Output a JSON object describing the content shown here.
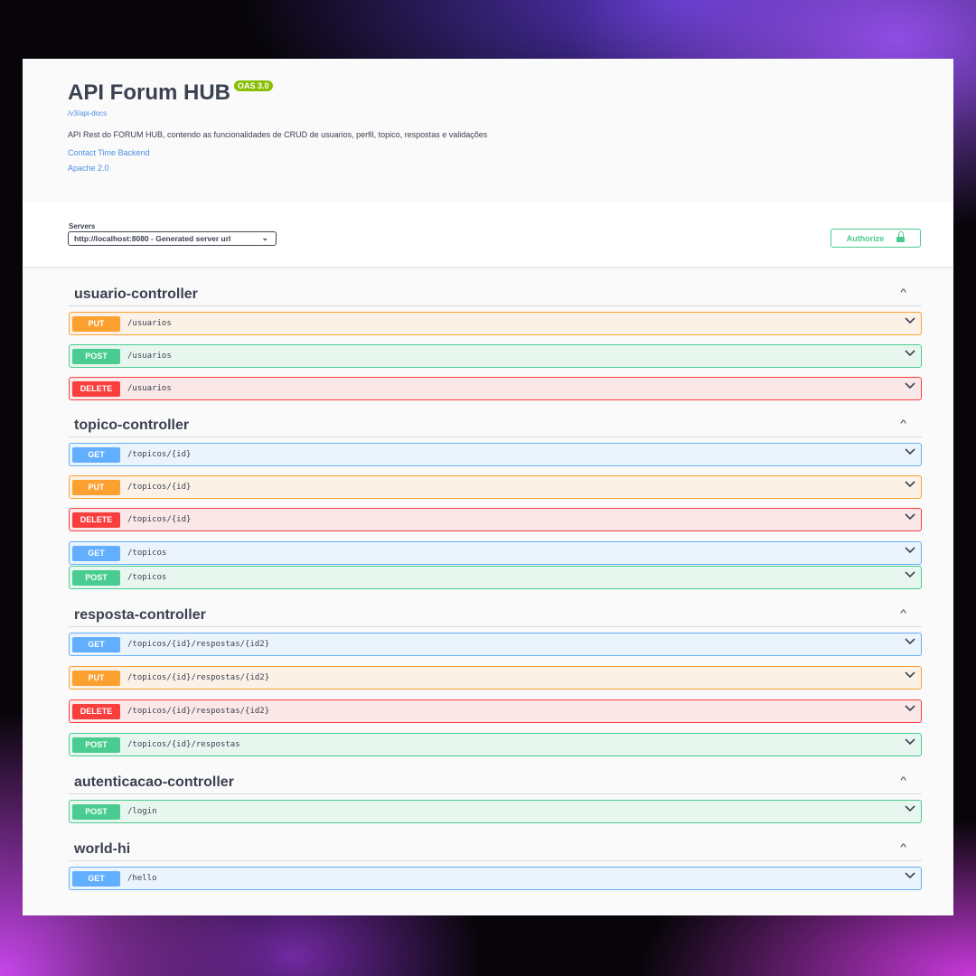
{
  "info": {
    "title": "API Forum HUB",
    "version_badge": "OAS 3.0",
    "spec_url": "/v3/api-docs",
    "description": "API Rest do FORUM HUB, contendo as funcionalidades de CRUD de usuarios, perfil, topico, respostas e validações",
    "contact_link": "Contact Time Backend",
    "license_link": "Apache 2.0"
  },
  "servers": {
    "label": "Servers",
    "selected": "http://localhost:8080 - Generated server url"
  },
  "authorize": {
    "label": "Authorize",
    "icon": "lock-icon"
  },
  "colors": {
    "get": "#61affe",
    "post": "#49cc90",
    "put": "#fca130",
    "delete": "#f93e3e"
  },
  "tags": [
    {
      "name": "usuario-controller",
      "ops": [
        {
          "method": "PUT",
          "path": "/usuarios"
        },
        {
          "method": "POST",
          "path": "/usuarios"
        },
        {
          "method": "DELETE",
          "path": "/usuarios"
        }
      ]
    },
    {
      "name": "topico-controller",
      "ops": [
        {
          "method": "GET",
          "path": "/topicos/{id}"
        },
        {
          "method": "PUT",
          "path": "/topicos/{id}"
        },
        {
          "method": "DELETE",
          "path": "/topicos/{id}"
        },
        {
          "method": "GET",
          "path": "/topicos"
        },
        {
          "method": "POST",
          "path": "/topicos"
        }
      ]
    },
    {
      "name": "resposta-controller",
      "ops": [
        {
          "method": "GET",
          "path": "/topicos/{id}/respostas/{id2}"
        },
        {
          "method": "PUT",
          "path": "/topicos/{id}/respostas/{id2}"
        },
        {
          "method": "DELETE",
          "path": "/topicos/{id}/respostas/{id2}"
        },
        {
          "method": "POST",
          "path": "/topicos/{id}/respostas"
        }
      ]
    },
    {
      "name": "autenticacao-controller",
      "ops": [
        {
          "method": "POST",
          "path": "/login"
        }
      ]
    },
    {
      "name": "world-hi",
      "ops": [
        {
          "method": "GET",
          "path": "/hello"
        }
      ]
    }
  ]
}
